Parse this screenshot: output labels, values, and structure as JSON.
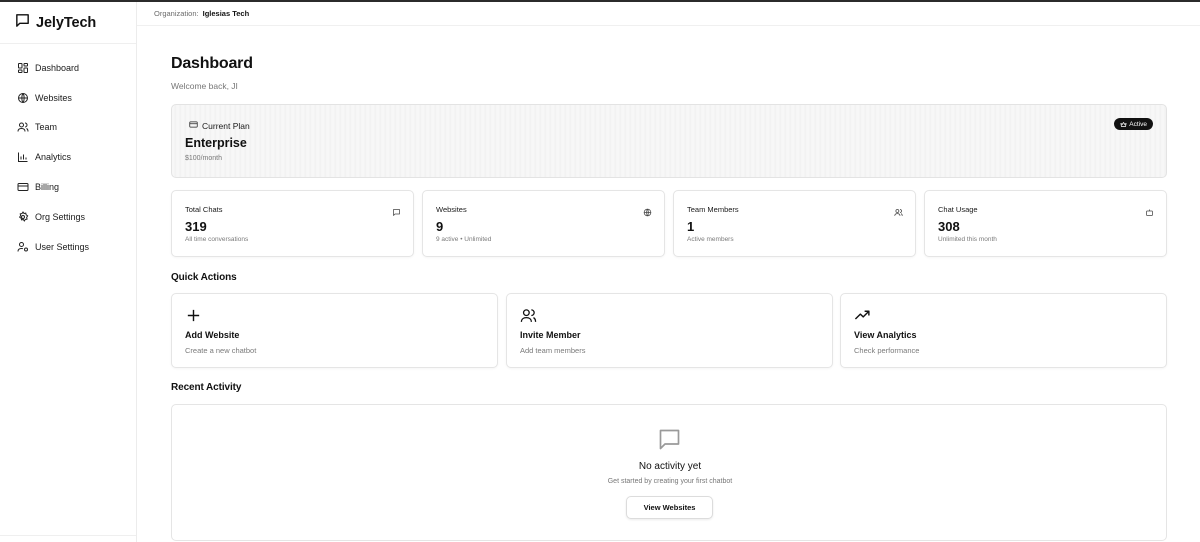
{
  "app": {
    "name": "JelyTech"
  },
  "sidebar": {
    "items": [
      {
        "label": "Dashboard",
        "icon": "dashboard-icon"
      },
      {
        "label": "Websites",
        "icon": "globe-icon"
      },
      {
        "label": "Team",
        "icon": "users-icon"
      },
      {
        "label": "Analytics",
        "icon": "bar-chart-icon"
      },
      {
        "label": "Billing",
        "icon": "credit-card-icon"
      },
      {
        "label": "Org Settings",
        "icon": "gear-icon"
      },
      {
        "label": "User Settings",
        "icon": "user-cog-icon"
      }
    ]
  },
  "topbar": {
    "org_label": "Organization:",
    "org_name": "Iglesias Tech"
  },
  "page": {
    "title": "Dashboard",
    "welcome": "Welcome back, JI"
  },
  "plan": {
    "label": "Current Plan",
    "name": "Enterprise",
    "price": "$100/month",
    "badge": "Active",
    "icon": "credit-card-icon",
    "badge_icon": "crown-icon"
  },
  "stats": [
    {
      "title": "Total Chats",
      "value": "319",
      "sub": "All time conversations",
      "icon": "message-icon"
    },
    {
      "title": "Websites",
      "value": "9",
      "sub": "9 active • Unlimited",
      "icon": "globe-icon"
    },
    {
      "title": "Team Members",
      "value": "1",
      "sub": "Active members",
      "icon": "users-icon"
    },
    {
      "title": "Chat Usage",
      "value": "308",
      "sub": "Unlimited this month",
      "icon": "bot-icon"
    }
  ],
  "quick_actions": {
    "title": "Quick Actions",
    "items": [
      {
        "title": "Add Website",
        "sub": "Create a new chatbot",
        "icon": "plus-icon"
      },
      {
        "title": "Invite Member",
        "sub": "Add team members",
        "icon": "users-icon"
      },
      {
        "title": "View Analytics",
        "sub": "Check performance",
        "icon": "trending-up-icon"
      }
    ]
  },
  "recent_activity": {
    "title": "Recent Activity",
    "empty_title": "No activity yet",
    "empty_sub": "Get started by creating your first chatbot",
    "button": "View Websites",
    "icon": "message-icon"
  },
  "colors": {
    "text": "#111111",
    "muted": "#777777",
    "border": "#e5e5e5",
    "badge_bg": "#111111"
  }
}
